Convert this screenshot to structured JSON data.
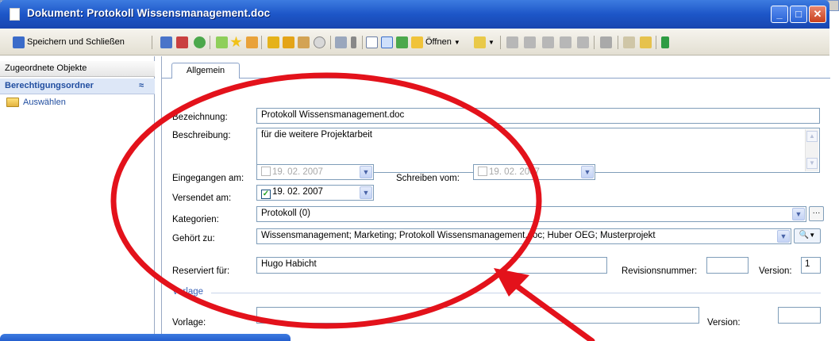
{
  "window": {
    "title": "Dokument: Protokoll Wissensmanagement.doc",
    "controls": [
      "_",
      "□",
      "✕"
    ]
  },
  "toolbar": {
    "save_close_label": "Speichern und Schließen",
    "open_label": "Öffnen"
  },
  "left_panel": {
    "header": "Zugeordnete Objekte",
    "section": "Berechtigungsordner",
    "item": "Auswählen"
  },
  "tabs": [
    "Allgemein"
  ],
  "form": {
    "bezeichnung_label": "Bezeichnung:",
    "bezeichnung_value": "Protokoll Wissensmanagement.doc",
    "beschreibung_label": "Beschreibung:",
    "beschreibung_value": "für die weitere Projektarbeit",
    "eingegangen_label": "Eingegangen am:",
    "eingegangen_value": "19. 02. 2007",
    "schreiben_label": "Schreiben vom:",
    "schreiben_value": "19. 02. 2007",
    "versendet_label": "Versendet am:",
    "versendet_value": "19. 02. 2007",
    "kategorien_label": "Kategorien:",
    "kategorien_value": "Protokoll (0)",
    "gehoert_label": "Gehört zu:",
    "gehoert_value": "Wissensmanagement; Marketing; Protokoll Wissensmanagement.doc; Huber OEG; Musterprojekt",
    "reserviert_label": "Reserviert für:",
    "reserviert_value": "Hugo Habicht",
    "revisionsnummer_label": "Revisionsnummer:",
    "revisionsnummer_value": "",
    "version_label": "Version:",
    "version_value": "1",
    "vorlage_section": "Vorlage",
    "vorlage_label": "Vorlage:",
    "vorlage_value": "",
    "vorlage_version_label": "Version:",
    "vorlage_version_value": ""
  },
  "background": {
    "text_fragment": "g"
  },
  "colors": {
    "titlebar": "#1d56c8",
    "link_blue": "#214ea0",
    "annotation_red": "#e3121b"
  }
}
